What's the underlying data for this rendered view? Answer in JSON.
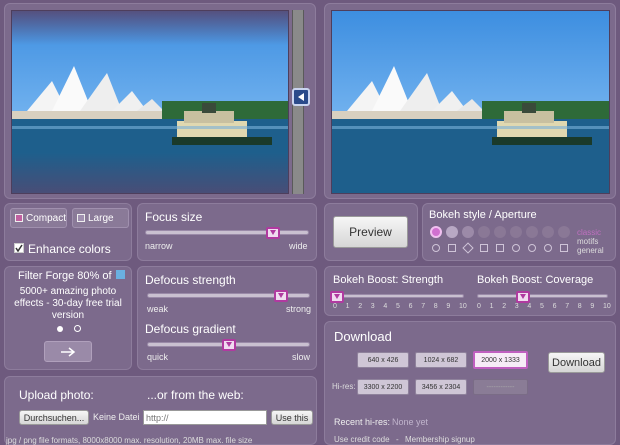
{
  "size_toggle": {
    "compact": "Compact",
    "large": "Large"
  },
  "enhance": {
    "label": "Enhance colors",
    "checked": true
  },
  "focus": {
    "title": "Focus size",
    "min": "narrow",
    "max": "wide",
    "value": 0.82
  },
  "preview": {
    "label": "Preview"
  },
  "bokeh": {
    "title": "Bokeh style / Aperture",
    "styles": [
      "classic",
      "motifs",
      "general"
    ]
  },
  "ad": {
    "title": "Filter Forge 80% of",
    "body": "5000+ amazing photo effects - 30-day free trial version",
    "next_icon": "right-arrow-icon"
  },
  "defocus_strength": {
    "title": "Defocus strength",
    "min": "weak",
    "max": "strong",
    "value": 0.85
  },
  "defocus_gradient": {
    "title": "Defocus gradient",
    "min": "quick",
    "max": "slow",
    "value": 0.52
  },
  "boost_strength": {
    "title": "Bokeh Boost: Strength",
    "value": 0,
    "ticks": [
      "0",
      "1",
      "2",
      "3",
      "4",
      "5",
      "6",
      "7",
      "8",
      "9",
      "10"
    ]
  },
  "boost_coverage": {
    "title": "Bokeh Boost: Coverage",
    "value": 4,
    "ticks": [
      "0",
      "1",
      "2",
      "3",
      "4",
      "5",
      "6",
      "7",
      "8",
      "9",
      "10"
    ]
  },
  "download": {
    "title": "Download",
    "sizes": [
      "640 x 426",
      "1024 x 682",
      "2000 x 1333"
    ],
    "active_size": 2,
    "button": "Download",
    "hires_label": "Hi-res:",
    "hires": [
      "3300 x 2200",
      "3456 x 2304",
      "------------"
    ],
    "recent_label": "Recent hi-res:",
    "recent_value": "None yet",
    "credit": "Use credit code",
    "separator": "-",
    "membership": "Membership signup"
  },
  "upload": {
    "title": "Upload photo:",
    "browse": "Durchsuchen...",
    "no_file": "Keine Datei",
    "web_title": "...or from the web:",
    "url_placeholder": "http://",
    "use_this": "Use this",
    "formats": "jpg / png file formats, 8000x8000 max. resolution, 20MB max. file size"
  },
  "colors": {
    "accent": "#b03aa0",
    "bg": "#6e5a7e",
    "panel": "#7c6a8c"
  }
}
